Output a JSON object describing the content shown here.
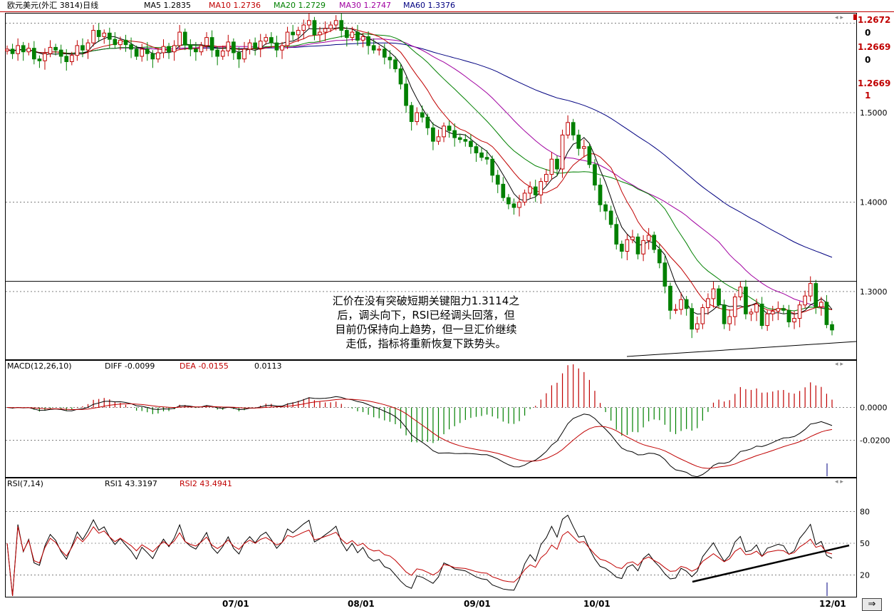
{
  "title": "欧元美元(外汇 3814)日线",
  "ma_labels": [
    {
      "text": "MA5 1.2835",
      "color": "#000000"
    },
    {
      "text": "MA10 1.2736",
      "color": "#c00000"
    },
    {
      "text": "MA20 1.2729",
      "color": "#008000"
    },
    {
      "text": "MA30 1.2747",
      "color": "#a000a0"
    },
    {
      "text": "MA60  1.3376",
      "color": "#000080"
    }
  ],
  "side_prices": [
    "1.2672",
    "0",
    "1.2669",
    "0",
    "1.2669",
    "1"
  ],
  "annotation": [
    "汇价在没有突破短期关键阻力1.3114之",
    "后，调头向下，RSI已经调头回落，但",
    "目前仍保持向上趋势，但一旦汇价继续",
    "走低，指标将重新恢复下跌势头。"
  ],
  "macd_header": {
    "name": "MACD(12,26,10)",
    "diff": "DIFF   -0.0099",
    "dea": "DEA   -0.0155",
    "macd": "0.0113"
  },
  "rsi_header": {
    "name": "RSI(7,14)",
    "rsi1": "RSI1   43.3197",
    "rsi2": "RSI2   43.4941"
  },
  "x_ticks": [
    "07/01",
    "08/01",
    "09/01",
    "10/01",
    "12/01"
  ],
  "chart_data": [
    {
      "type": "candlestick",
      "title": "欧元美元(外汇 3814)日线",
      "y_ticks": [
        "1.5000",
        "1.4000",
        "1.3000"
      ],
      "resistance_level": 1.3114,
      "ylim": [
        1.225,
        1.61
      ],
      "series_colors": {
        "up": "#c00000",
        "down": "#008000",
        "MA5": "#000000",
        "MA10": "#c00000",
        "MA20": "#008000",
        "MA30": "#a000a0",
        "MA60": "#000080"
      },
      "close": [
        1.571,
        1.566,
        1.575,
        1.568,
        1.572,
        1.56,
        1.558,
        1.566,
        1.573,
        1.57,
        1.563,
        1.557,
        1.564,
        1.575,
        1.57,
        1.578,
        1.592,
        1.585,
        1.589,
        1.582,
        1.576,
        1.581,
        1.576,
        1.571,
        1.563,
        1.571,
        1.566,
        1.56,
        1.567,
        1.574,
        1.568,
        1.575,
        1.59,
        1.576,
        1.571,
        1.568,
        1.575,
        1.584,
        1.57,
        1.563,
        1.569,
        1.579,
        1.567,
        1.56,
        1.571,
        1.578,
        1.572,
        1.58,
        1.584,
        1.578,
        1.57,
        1.575,
        1.59,
        1.587,
        1.592,
        1.598,
        1.603,
        1.587,
        1.59,
        1.594,
        1.598,
        1.603,
        1.592,
        1.584,
        1.59,
        1.581,
        1.585,
        1.575,
        1.57,
        1.571,
        1.562,
        1.559,
        1.549,
        1.532,
        1.508,
        1.49,
        1.5,
        1.495,
        1.483,
        1.468,
        1.473,
        1.485,
        1.48,
        1.472,
        1.47,
        1.468,
        1.462,
        1.455,
        1.45,
        1.448,
        1.43,
        1.42,
        1.405,
        1.398,
        1.394,
        1.4,
        1.41,
        1.417,
        1.408,
        1.423,
        1.431,
        1.448,
        1.437,
        1.475,
        1.489,
        1.475,
        1.46,
        1.462,
        1.442,
        1.419,
        1.397,
        1.39,
        1.375,
        1.353,
        1.345,
        1.358,
        1.361,
        1.342,
        1.357,
        1.363,
        1.347,
        1.332,
        1.306,
        1.279,
        1.28,
        1.291,
        1.281,
        1.258,
        1.264,
        1.282,
        1.292,
        1.303,
        1.285,
        1.264,
        1.272,
        1.294,
        1.305,
        1.275,
        1.277,
        1.286,
        1.262,
        1.275,
        1.278,
        1.281,
        1.279,
        1.266,
        1.27,
        1.285,
        1.295,
        1.309,
        1.283,
        1.288,
        1.263,
        1.257
      ]
    },
    {
      "type": "macd",
      "title": "MACD(12,26,10)",
      "y_ticks": [
        "0.0000",
        "-0.0200"
      ],
      "ylim": [
        -0.042,
        0.022
      ],
      "diff_last": -0.0099,
      "dea_last": -0.0155,
      "macd_last": 0.0113
    },
    {
      "type": "rsi",
      "title": "RSI(7,14)",
      "y_ticks": [
        "80",
        "50",
        "20"
      ],
      "ylim": [
        0,
        100
      ],
      "rsi1_last": 43.3197,
      "rsi2_last": 43.4941
    }
  ]
}
